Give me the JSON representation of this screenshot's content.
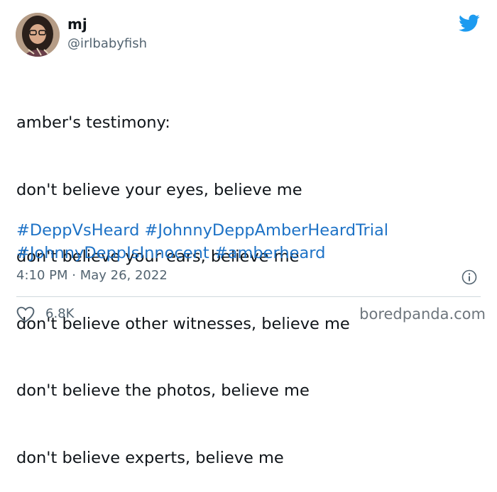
{
  "user": {
    "display_name": "mj",
    "handle": "@irlbabyfish"
  },
  "tweet": {
    "text_lines": [
      "amber's testimony:",
      "don't believe your eyes, believe me",
      "don't believe your ears, believe me",
      "don't believe other witnesses, believe me",
      "don't believe the photos, believe me",
      "don't believe experts, believe me"
    ],
    "hashtags": [
      "#DeppVsHeard",
      "#JohnnyDeppAmberHeardTrial",
      "#JohnnyDeppIsInnocent",
      "#amberheard"
    ],
    "timestamp": "4:10 PM · May 26, 2022",
    "likes": "6.8K"
  },
  "icons": {
    "logo": "twitter-bird-icon",
    "info": "info-icon",
    "like": "heart-icon"
  },
  "colors": {
    "accent": "#1d9bf0",
    "hashtag": "#1d72c6",
    "muted": "#536471"
  },
  "watermark": "boredpanda.com"
}
